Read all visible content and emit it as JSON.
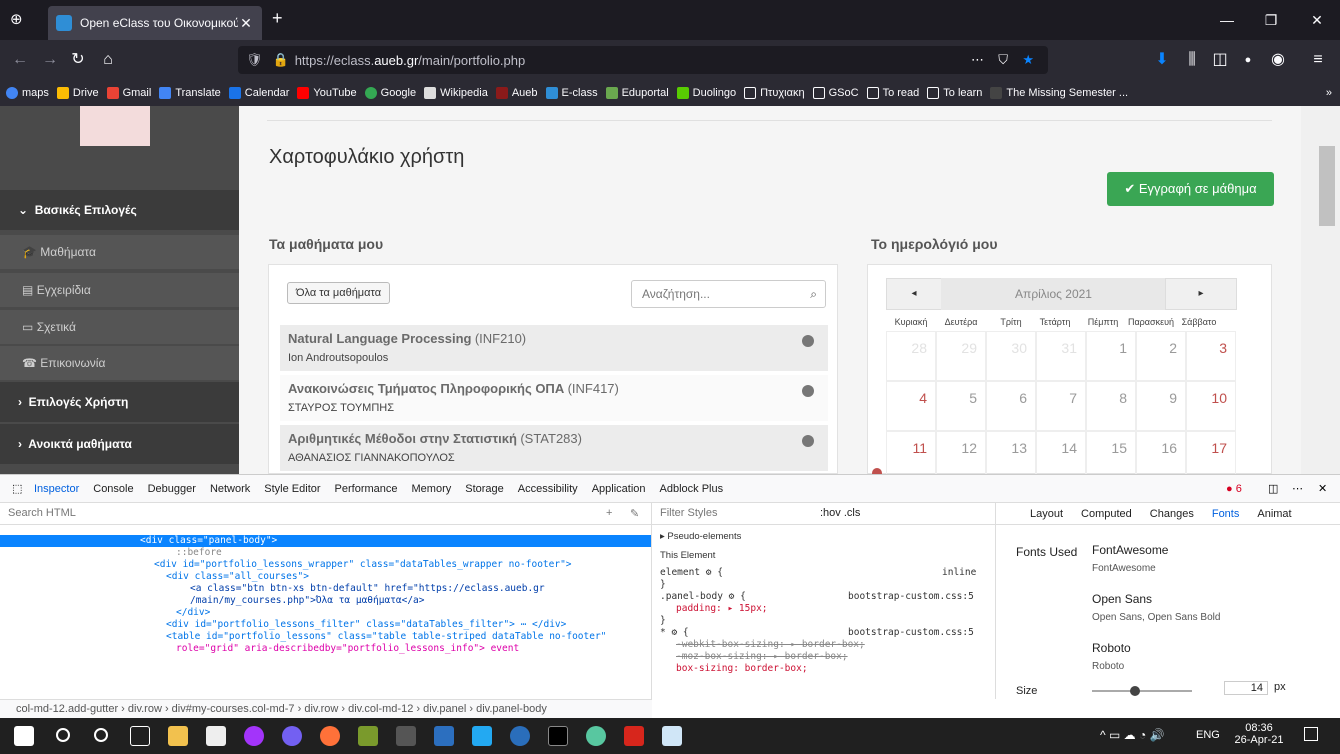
{
  "browser": {
    "tab_title": "Open eClass του Οικονομικού",
    "url_prefix": "https://eclass.",
    "url_host": "aueb.gr",
    "url_path": "/main/portfolio.php",
    "bookmarks": [
      "maps",
      "Drive",
      "Gmail",
      "Translate",
      "Calendar",
      "YouTube",
      "Google",
      "Wikipedia",
      "Aueb",
      "E-class",
      "Eduportal",
      "Duolingo",
      "Πτυχιακη",
      "GSoC",
      "To read",
      "To learn",
      "The Missing Semester ..."
    ]
  },
  "sidebar": {
    "sections": [
      {
        "label": "Βασικές Επιλογές"
      },
      {
        "label": "Επιλογές Χρήστη"
      },
      {
        "label": "Ανοικτά μαθήματα"
      }
    ],
    "items": [
      {
        "label": "Μαθήματα"
      },
      {
        "label": "Εγχειρίδια"
      },
      {
        "label": "Σχετικά"
      },
      {
        "label": "Επικοινωνία"
      }
    ]
  },
  "main": {
    "title": "Χαρτοφυλάκιο χρήστη",
    "enroll_button": "✔ Εγγραφή σε μάθημα",
    "lessons_heading": "Τα μαθήματα μου",
    "calendar_heading": "Το ημερολόγιό μου",
    "all_courses_button": "Όλα τα μαθήματα",
    "search_placeholder": "Αναζήτηση...",
    "lessons": [
      {
        "name": "Natural Language Processing",
        "code": "(INF210)",
        "prof": "Ion Androutsopoulos"
      },
      {
        "name": "Ανακοινώσεις Τμήματος Πληροφορικής ΟΠΑ",
        "code": "(INF417)",
        "prof": "ΣΤΑΥΡΟΣ ΤΟΥΜΠΗΣ"
      },
      {
        "name": "Αριθμητικές Μέθοδοι στην Στατιστική",
        "code": "(STAT283)",
        "prof": "ΑΘΑΝΑΣΙΟΣ ΓΙΑΝΝΑΚΟΠΟΥΛΟΣ"
      }
    ],
    "calendar": {
      "month": "Απρίλιος 2021",
      "prev": "◂",
      "next": "▸",
      "weekdays": [
        "Κυριακή",
        "Δευτέρα",
        "Τρίτη",
        "Τετάρτη",
        "Πέμπτη",
        "Παρασκευή",
        "Σάββατο"
      ],
      "week1": [
        "28",
        "29",
        "30",
        "31",
        "1",
        "2",
        "3"
      ],
      "week2": [
        "4",
        "5",
        "6",
        "7",
        "8",
        "9",
        "10"
      ],
      "week3": [
        "11",
        "12",
        "13",
        "14",
        "15",
        "16",
        "17"
      ]
    }
  },
  "devtools": {
    "tabs": [
      "Inspector",
      "Console",
      "Debugger",
      "Network",
      "Style Editor",
      "Performance",
      "Memory",
      "Storage",
      "Accessibility",
      "Application",
      "Adblock Plus"
    ],
    "error_count": "6",
    "html_search_placeholder": "Search HTML",
    "filter_styles_placeholder": "Filter Styles",
    "rules_toggles": ":hov .cls",
    "html_lines": [
      "<div class=\"panel-body\">",
      "::before",
      "<div id=\"portfolio_lessons_wrapper\" class=\"dataTables_wrapper no-footer\">",
      "<div class=\"all_courses\">",
      "<a class=\"btn btn-xs btn-default\" href=\"https://eclass.aueb.gr",
      "/main/my_courses.php\">Όλα τα μαθήματα</a>",
      "</div>",
      "<div id=\"portfolio_lessons_filter\" class=\"dataTables_filter\"> ⋯ </div>",
      "<table id=\"portfolio_lessons\" class=\"table table-striped dataTable no-footer\"",
      "role=\"grid\" aria-describedby=\"portfolio_lessons_info\"> event"
    ],
    "rules": {
      "pseudo": "Pseudo-elements",
      "this_element": "This Element",
      "element_rule": "element ⚙ {",
      "inline": "inline",
      "panel_body_rule": ".panel-body ⚙ {",
      "source": "bootstrap-custom.css:5",
      "padding": "padding: ▸ 15px;",
      "star_rule": "* ⚙ {",
      "webkit": "-webkit-box-sizing: ▸ border-box;",
      "moz": "-moz-box-sizing: ▸ border-box;",
      "box_sizing": "box-sizing: border-box;"
    },
    "side_tabs": [
      "Layout",
      "Computed",
      "Changes",
      "Fonts",
      "Animat"
    ],
    "fonts_used_label": "Fonts Used",
    "fonts": [
      {
        "family": "FontAwesome",
        "faces": "FontAwesome"
      },
      {
        "family": "Open Sans",
        "faces": "Open Sans, Open Sans Bold"
      },
      {
        "family": "Roboto",
        "faces": "Roboto"
      }
    ],
    "size_label": "Size",
    "size_value": "14",
    "size_unit": "px",
    "breadcrumb": "col-md-12.add-gutter › div.row › div#my-courses.col-md-7 › div.row › div.col-md-12 › div.panel › div.panel-body"
  },
  "taskbar": {
    "lang": "ENG",
    "time": "08:36",
    "date": "26-Apr-21"
  },
  "colors": {
    "accent_green": "#3aa654",
    "devtools_blue": "#0a84ff",
    "weekend_red": "#c0504d"
  }
}
